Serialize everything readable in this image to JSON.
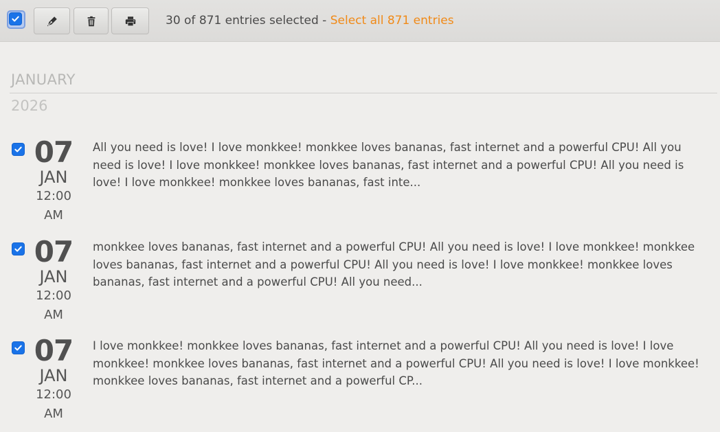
{
  "toolbar": {
    "select_all_checked": true,
    "buttons": [
      {
        "icon": "pen-icon",
        "label": "Edit"
      },
      {
        "icon": "trash-icon",
        "label": "Delete"
      },
      {
        "icon": "printer-icon",
        "label": "Print"
      }
    ],
    "selection_text": "30 of 871 entries selected - ",
    "select_all_link": "Select all 871 entries"
  },
  "section": {
    "month": "JANUARY",
    "year": "2026"
  },
  "colors": {
    "accent_link": "#f08a18",
    "checkbox": "#1a73e8"
  },
  "entries": [
    {
      "checked": true,
      "day": "07",
      "month": "JAN",
      "time": "12:00",
      "ampm": "AM",
      "text": "All you need is love! I love monkkee! monkkee loves bananas, fast internet and a powerful CPU! All you need is love! I love monkkee! monkkee loves bananas, fast internet and a powerful CPU! All you need is love! I love monkkee! monkkee loves bananas, fast inte..."
    },
    {
      "checked": true,
      "day": "07",
      "month": "JAN",
      "time": "12:00",
      "ampm": "AM",
      "text": "monkkee loves bananas, fast internet and a powerful CPU! All you need is love! I love monkkee! monkkee loves bananas, fast internet and a powerful CPU! All you need is love! I love monkkee! monkkee loves bananas, fast internet and a powerful CPU! All you need..."
    },
    {
      "checked": true,
      "day": "07",
      "month": "JAN",
      "time": "12:00",
      "ampm": "AM",
      "text": "I love monkkee! monkkee loves bananas, fast internet and a powerful CPU! All you need is love! I love monkkee! monkkee loves bananas, fast internet and a powerful CPU! All you need is love! I love monkkee! monkkee loves bananas, fast internet and a powerful CP..."
    }
  ]
}
